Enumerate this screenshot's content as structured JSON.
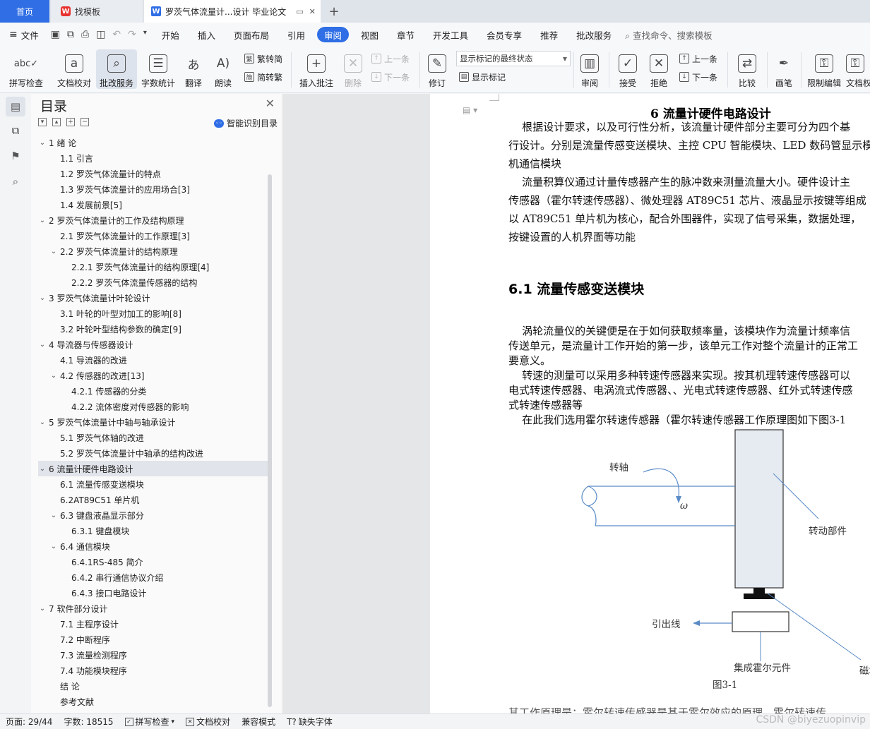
{
  "tabs": {
    "home": "首页",
    "templates": "找模板",
    "document": "罗茨气体流量计...设计 毕业论文"
  },
  "menu": {
    "file": "文件",
    "items": [
      "开始",
      "插入",
      "页面布局",
      "引用",
      "审阅",
      "视图",
      "章节",
      "开发工具",
      "会员专享",
      "推荐",
      "批改服务"
    ],
    "active": "审阅",
    "search": "查找命令、搜索模板"
  },
  "ribbon": {
    "spell_check": "拼写检查",
    "doc_proof": "文档校对",
    "correct_service": "批改服务",
    "word_count": "字数统计",
    "translate": "翻译",
    "read_aloud": "朗读",
    "trad_to_simp": "繁转简",
    "simp_to_trad": "简转繁",
    "insert_comment": "插入批注",
    "delete": "删除",
    "prev": "上一条",
    "next": "下一条",
    "track_changes": "修订",
    "markup_state": "显示标记的最终状态",
    "show_markup": "显示标记",
    "review": "审阅",
    "accept": "接受",
    "reject": "拒绝",
    "prev2": "上一条",
    "next2": "下一条",
    "compare": "比较",
    "pen": "画笔",
    "restrict_edit": "限制编辑",
    "doc_rights": "文档权"
  },
  "toc": {
    "title": "目录",
    "ai_label": "智能识别目录",
    "items": [
      {
        "level": 1,
        "text": "1 绪    论",
        "chev": "v"
      },
      {
        "level": 2,
        "text": "1.1  引言",
        "chev": ""
      },
      {
        "level": 2,
        "text": "1.2  罗茨气体流量计的特点",
        "chev": ""
      },
      {
        "level": 2,
        "text": "1.3 罗茨气体流量计的应用场合[3]",
        "chev": ""
      },
      {
        "level": 2,
        "text": "1.4  发展前景[5]",
        "chev": ""
      },
      {
        "level": 1,
        "text": "2 罗茨气体流量计的工作及结构原理",
        "chev": "v"
      },
      {
        "level": 2,
        "text": "2.1  罗茨气体流量计的工作原理[3]",
        "chev": ""
      },
      {
        "level": 2,
        "text": "2.2 罗茨气体流量计的结构原理",
        "chev": "v"
      },
      {
        "level": 3,
        "text": "2.2.1  罗茨气体流量计的结构原理[4]",
        "chev": ""
      },
      {
        "level": 3,
        "text": "2.2.2  罗茨气体流量传感器的结构",
        "chev": ""
      },
      {
        "level": 1,
        "text": "3 罗茨气体流量计叶轮设计",
        "chev": "v"
      },
      {
        "level": 2,
        "text": "3.1 叶轮的叶型对加工的影响[8]",
        "chev": ""
      },
      {
        "level": 2,
        "text": "3.2 叶轮叶型结构参数的确定[9]",
        "chev": ""
      },
      {
        "level": 1,
        "text": "4  导流器与传感器设计",
        "chev": "v"
      },
      {
        "level": 2,
        "text": "4.1 导流器的改进",
        "chev": ""
      },
      {
        "level": 2,
        "text": "4.2 传感器的改进[13]",
        "chev": "v"
      },
      {
        "level": 3,
        "text": "4.2.1  传感器的分类",
        "chev": ""
      },
      {
        "level": 3,
        "text": "4.2.2 流体密度对传感器的影响",
        "chev": ""
      },
      {
        "level": 1,
        "text": "5  罗茨气体流量计中轴与轴承设计",
        "chev": "v"
      },
      {
        "level": 2,
        "text": "5.1  罗茨气体轴的改进",
        "chev": ""
      },
      {
        "level": 2,
        "text": "5.2  罗茨气体流量计中轴承的结构改进",
        "chev": ""
      },
      {
        "level": 1,
        "text": "6 流量计硬件电路设计",
        "chev": "v",
        "selected": true
      },
      {
        "level": 2,
        "text": "6.1 流量传感变送模块",
        "chev": ""
      },
      {
        "level": 2,
        "text": "6.2AT89C51 单片机",
        "chev": ""
      },
      {
        "level": 2,
        "text": "6.3 键盘液晶显示部分",
        "chev": "v"
      },
      {
        "level": 3,
        "text": "6.3.1  键盘模块",
        "chev": ""
      },
      {
        "level": 2,
        "text": "6.4 通信模块",
        "chev": "v"
      },
      {
        "level": 3,
        "text": "6.4.1RS-485 简介",
        "chev": ""
      },
      {
        "level": 3,
        "text": "6.4.2 串行通信协议介绍",
        "chev": ""
      },
      {
        "level": 3,
        "text": "6.4.3 接口电路设计",
        "chev": ""
      },
      {
        "level": 1,
        "text": "7  软件部分设计",
        "chev": "v"
      },
      {
        "level": 2,
        "text": "7.1    主程序设计",
        "chev": ""
      },
      {
        "level": 2,
        "text": "7.2    中断程序",
        "chev": ""
      },
      {
        "level": 2,
        "text": "7.3  流量检测程序",
        "chev": ""
      },
      {
        "level": 2,
        "text": "7.4    功能模块程序",
        "chev": ""
      },
      {
        "level": 0,
        "text": "结    论",
        "chev": ""
      },
      {
        "level": 0,
        "text": "参考文献",
        "chev": ""
      }
    ]
  },
  "doc": {
    "h1": "6 流量计硬件电路设计",
    "p1": [
      "    根据设计要求，以及可行性分析，该流量计硬件部分主要可分为四个基",
      "行设计。分别是流量传感变送模块、主控 CPU 智能模块、LED 数码管显示模",
      "机通信模块"
    ],
    "p2": [
      "    流量积算仪通过计量传感器产生的脉冲数来测量流量大小。硬件设计主",
      "传感器（霍尔转速传感器）、微处理器 AT89C51 芯片、液晶显示按键等组成",
      "以 AT89C51 单片机为核心，配合外围器件，实现了信号采集，数据处理，",
      "按键设置的人机界面等功能"
    ],
    "h2": "6.1 流量传感变送模块",
    "p3": [
      "    涡轮流量仪的关键便是在于如何获取频率量，该模块作为流量计频率信",
      "传送单元，是流量计工作开始的第一步，该单元工作对整个流量计的正常工",
      "要意义。",
      "    转速的测量可以采用多种转速传感器来实现。按其机理转速传感器可以",
      "电式转速传感器、电涡流式传感器、、光电式转速传感器、红外式转速传感",
      "式转速传感器等",
      "    在此我们选用霍尔转速传感器（霍尔转速传感器工作原理图如下图3-1"
    ],
    "figure": {
      "shaft": "转轴",
      "omega": "ω",
      "rotor": "转动部件",
      "lead": "引出线",
      "magnet": "磁块",
      "hall": "集成霍尔元件",
      "caption": "图3-1"
    },
    "bottom_line": "其工作原理是：霍尔转速传感器是基于霍尔效应的原理，霍尔转速传"
  },
  "status": {
    "page": "页面: 29/44",
    "words": "字数: 18515",
    "spell": "拼写检查",
    "proof": "文档校对",
    "compat": "兼容模式",
    "missing_font": "缺失字体",
    "watermark": "CSDN @biyezuopinvip"
  }
}
